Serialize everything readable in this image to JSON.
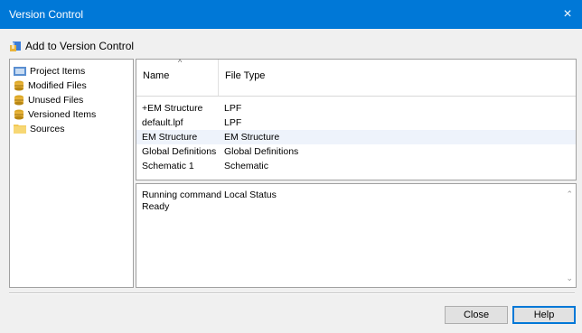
{
  "window": {
    "title": "Version Control",
    "close_glyph": "×",
    "accent_color": "#0078d7"
  },
  "toolbar": {
    "add_label": "Add to Version Control",
    "add_icon": "add-to-vc-icon"
  },
  "tree": {
    "items": [
      {
        "label": "Project Items",
        "icon": "project-items-icon"
      },
      {
        "label": "Modified Files",
        "icon": "database-icon"
      },
      {
        "label": "Unused Files",
        "icon": "database-icon"
      },
      {
        "label": "Versioned Items",
        "icon": "database-icon"
      },
      {
        "label": "Sources",
        "icon": "folder-icon"
      }
    ]
  },
  "grid": {
    "columns": [
      {
        "label": "Name",
        "sort": "ascending"
      },
      {
        "label": "File Type"
      }
    ],
    "rows": [
      {
        "name": "+EM Structure",
        "type": "LPF"
      },
      {
        "name": "default.lpf",
        "type": "LPF"
      },
      {
        "name": "EM Structure",
        "type": "EM Structure"
      },
      {
        "name": "Global Definitions",
        "type": "Global Definitions"
      },
      {
        "name": "Schematic 1",
        "type": "Schematic"
      }
    ],
    "selected_row": 2
  },
  "log": {
    "lines": [
      "Running command Local Status",
      "Ready"
    ]
  },
  "buttons": {
    "close_label": "Close",
    "help_label": "Help"
  }
}
